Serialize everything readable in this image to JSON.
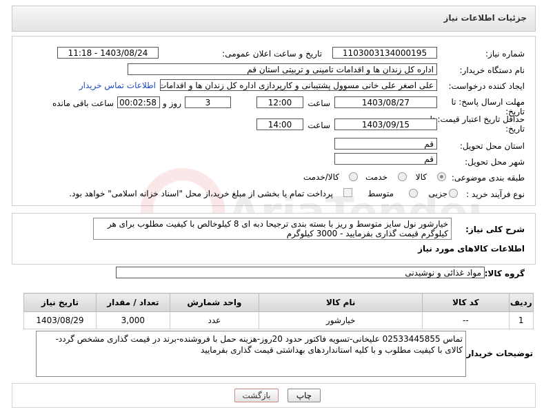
{
  "header": {
    "title": "جزئیات اطلاعات نیاز"
  },
  "form": {
    "need_number_label": "شماره نیاز:",
    "need_number": "1103003134000195",
    "announce_label": "تاریخ و ساعت اعلان عمومی:",
    "announce_value": "1403/08/24 - 11:18",
    "buyer_org_label": "نام دستگاه خریدار:",
    "buyer_org": "اداره کل زندان ها و اقدامات تامینی و تربیتی استان قم",
    "creator_label": "ایجاد کننده درخواست:",
    "creator": "علی اصغر علی خانی مسوول پشتیبانی و کارپردازی اداره کل زندان ها و اقدامات",
    "contact_link": "اطلاعات تماس خریدار",
    "deadline_label": "مهلت ارسال پاسخ: تا",
    "deadline_label2": "تاریخ:",
    "deadline_date": "1403/08/27",
    "time_label": "ساعت",
    "deadline_time": "12:00",
    "days_value": "3",
    "days_label": "روز و",
    "remaining_value": "00:02:58",
    "remaining_label": "ساعت باقی مانده",
    "validity_label": "حداقل تاریخ اعتبار قیمت: تا",
    "validity_label2": "تاریخ:",
    "validity_date": "1403/09/15",
    "validity_time": "14:00",
    "province_label": "استان محل تحویل:",
    "province": "قم",
    "city_label": "شهر محل تحویل:",
    "city": "قم",
    "category_label": "طبقه بندی موضوعی:",
    "category_options": [
      "کالا",
      "خدمت",
      "کالا/خدمت"
    ],
    "category_selected": "کالا",
    "process_label": "نوع فرآیند خرید :",
    "process_options": [
      "جزیی",
      "متوسط"
    ],
    "process_note": "پرداخت تمام یا بخشی از مبلغ خرید،از محل \"اسناد خزانه اسلامی\" خواهد بود."
  },
  "description": {
    "label": "شرح کلی نیاز:",
    "text": "خیارشور نول سایز متوسط و ریز با بسته بندی ترجیحا دبه ای 8 کیلوخالص با کیفیت مطلوب برای هر کیلوگرم قیمت گذاری بفرمایید - 3000 کیلوگرم"
  },
  "goods_section": {
    "title": "اطلاعات کالاهای مورد نیاز",
    "group_label": "گروه کالا:",
    "group_value": "مواد غذائی و نوشیدنی"
  },
  "table": {
    "headers": [
      "ردیف",
      "کد کالا",
      "نام کالا",
      "واحد شمارش",
      "تعداد / مقدار",
      "تاریخ نیاز"
    ],
    "rows": [
      [
        "1",
        "--",
        "خیارشور",
        "عدد",
        "3,000",
        "1403/08/29"
      ]
    ]
  },
  "buyer_notes": {
    "label": "توضیحات خریدار:",
    "text": "تماس 02533445855 علیخانی-تسویه فاکتور حدود 20روز-هزینه حمل با فروشنده-برند در قیمت گذاری مشخص گردد-کالای با کیفیت مطلوب و با کلیه استانداردهای بهداشتی قیمت گذاری بفرمایید"
  },
  "buttons": {
    "print": "چاپ",
    "back": "بازگشت"
  },
  "watermark": {
    "text": "AriaTender.neT"
  }
}
